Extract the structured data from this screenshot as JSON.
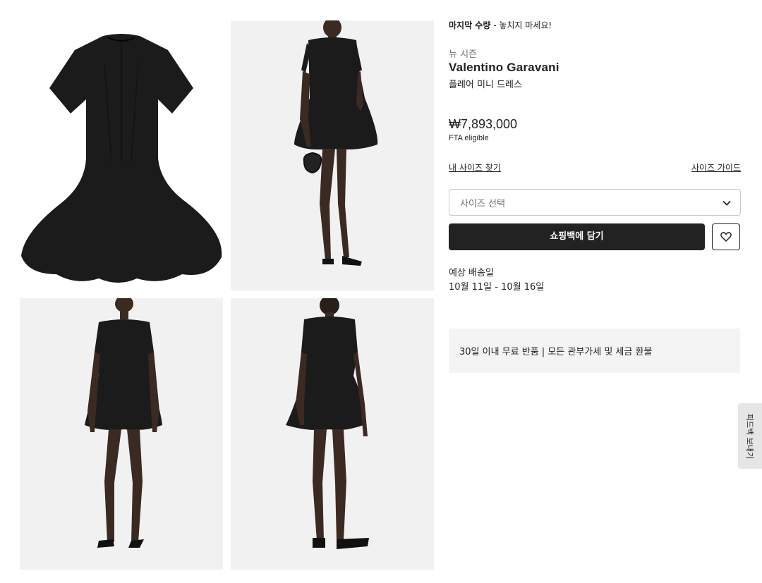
{
  "gallery": {
    "images": [
      {
        "alt": "dress-flat-front"
      },
      {
        "alt": "model-side-with-bag"
      },
      {
        "alt": "model-front"
      },
      {
        "alt": "model-back"
      }
    ]
  },
  "product": {
    "stock_notice_bold": "마지막 수량",
    "stock_notice_rest": " - 놓치지 마세요!",
    "season": "뉴 시즌",
    "brand": "Valentino Garavani",
    "name": "플레어 미니 드레스",
    "price": "₩7,893,000",
    "tax_note": "FTA eligible"
  },
  "size": {
    "find_size_link": "내 사이즈 찾기",
    "size_guide_link": "사이즈 가이드",
    "select_placeholder": "사이즈 선택",
    "chevron_icon": "chevron-down-icon"
  },
  "actions": {
    "add_to_bag": "쇼핑백에 담기",
    "wishlist_icon": "heart-icon"
  },
  "shipping": {
    "label": "예상 배송일",
    "dates": "10월 11일 - 10월 16일"
  },
  "notice": {
    "text": "30일 이내 무료 반품 | 모든 관부가세 및 세금 환불"
  },
  "feedback": {
    "label": "피드백 보내기"
  },
  "colors": {
    "primary_button": "#222222",
    "notice_bg": "#f4f4f4",
    "feedback_tab_bg": "#e6e6e6"
  }
}
